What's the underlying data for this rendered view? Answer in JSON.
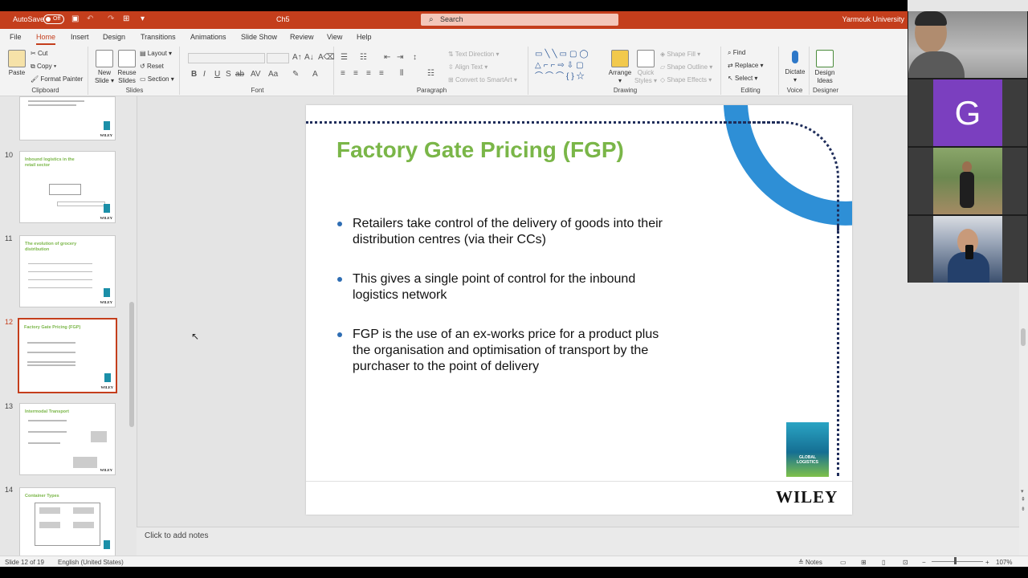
{
  "titlebar": {
    "autosave_label": "AutoSave",
    "autosave_state": "Off",
    "document_name": "Ch5",
    "search_placeholder": "Search",
    "account_name": "Yarmouk University"
  },
  "ribbon_tabs": [
    "File",
    "Home",
    "Insert",
    "Design",
    "Transitions",
    "Animations",
    "Slide Show",
    "Review",
    "View",
    "Help"
  ],
  "active_tab": "Home",
  "ribbon": {
    "clipboard": {
      "paste": "Paste",
      "cut": "Cut",
      "copy": "Copy",
      "format_painter": "Format Painter",
      "label": "Clipboard"
    },
    "slides": {
      "new_slide_l1": "New",
      "new_slide_l2": "Slide",
      "reuse_l1": "Reuse",
      "reuse_l2": "Slides",
      "layout": "Layout",
      "reset": "Reset",
      "section": "Section",
      "label": "Slides"
    },
    "font": {
      "label": "Font"
    },
    "paragraph": {
      "text_direction": "Text Direction",
      "align_text": "Align Text",
      "convert_smartart": "Convert to SmartArt",
      "label": "Paragraph"
    },
    "drawing": {
      "arrange": "Arrange",
      "quick_styles_l1": "Quick",
      "quick_styles_l2": "Styles",
      "shape_fill": "Shape Fill",
      "shape_outline": "Shape Outline",
      "shape_effects": "Shape Effects",
      "label": "Drawing"
    },
    "editing": {
      "find": "Find",
      "replace": "Replace",
      "select": "Select",
      "label": "Editing"
    },
    "voice": {
      "dictate": "Dictate",
      "label": "Voice"
    },
    "designer": {
      "design_ideas_l1": "Design",
      "design_ideas_l2": "Ideas",
      "label": "Designer"
    }
  },
  "thumbnails": [
    {
      "number": "10",
      "title": "Inbound logistics in the retail sector"
    },
    {
      "number": "11",
      "title": "The evolution of grocery distribution"
    },
    {
      "number": "12",
      "title": "Factory Gate Pricing (FGP)"
    },
    {
      "number": "13",
      "title": "Intermodal Transport"
    },
    {
      "number": "14",
      "title": "Container Types"
    }
  ],
  "thumb_wiley": "WILEY",
  "active_thumbnail": "12",
  "slide": {
    "title": "Factory Gate Pricing (FGP)",
    "bullets": [
      "Retailers take control of the delivery of goods into their distribution centres (via their CCs)",
      "This gives a single point of control for the inbound logistics network",
      "FGP is the use of an ex-works price for a product plus the organisation and optimisation of transport by the purchaser to the point of delivery"
    ],
    "book_title": "GLOBAL LOGISTICS",
    "publisher": "WILEY"
  },
  "notes_placeholder": "Click to add notes",
  "status": {
    "slide_counter": "Slide 12 of 19",
    "language": "English (United States)",
    "notes_button": "Notes",
    "zoom": "107%"
  },
  "video": {
    "participant_initial": "G"
  },
  "colors": {
    "accent": "#c43e1c",
    "title_green": "#7ab648",
    "arc_blue": "#2e8fd6",
    "avatar_purple": "#7b3fbf"
  }
}
